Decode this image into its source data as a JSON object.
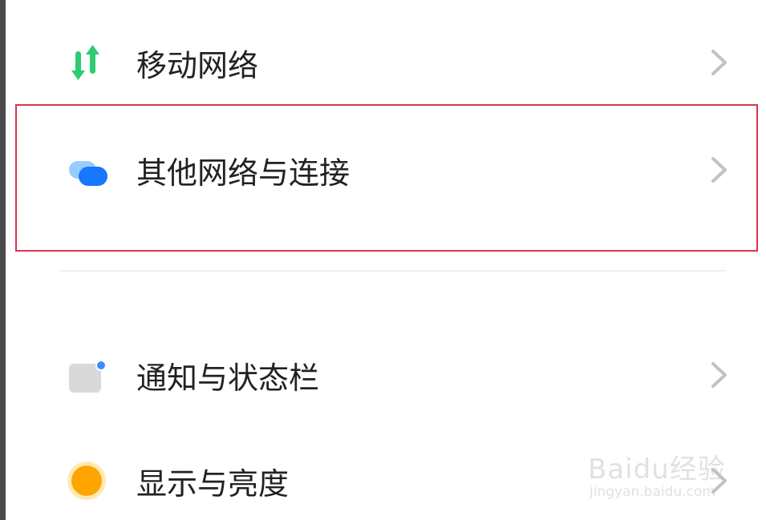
{
  "settings": {
    "items": [
      {
        "label": "移动网络",
        "icon": "mobile-data-icon"
      },
      {
        "label": "其他网络与连接",
        "icon": "connection-bubbles-icon"
      },
      {
        "label": "通知与状态栏",
        "icon": "notification-icon"
      },
      {
        "label": "显示与亮度",
        "icon": "brightness-icon"
      }
    ]
  },
  "watermark": {
    "main": "Baidu经验",
    "sub": "jingyan.baidu.com"
  },
  "colors": {
    "highlight_border": "#e0324a",
    "green_icon": "#2ecc71",
    "blue_icon": "#1677ff",
    "orange_icon": "#ffa500"
  }
}
